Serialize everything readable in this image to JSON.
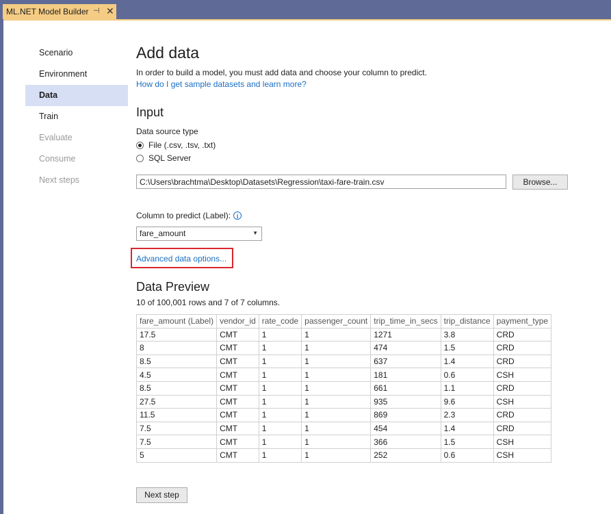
{
  "window": {
    "tab_title": "ML.NET Model Builder",
    "pin_icon": "pin-icon",
    "close_icon": "close-icon"
  },
  "sidebar": {
    "items": [
      {
        "label": "Scenario",
        "state": "normal"
      },
      {
        "label": "Environment",
        "state": "normal"
      },
      {
        "label": "Data",
        "state": "active"
      },
      {
        "label": "Train",
        "state": "normal"
      },
      {
        "label": "Evaluate",
        "state": "disabled"
      },
      {
        "label": "Consume",
        "state": "disabled"
      },
      {
        "label": "Next steps",
        "state": "disabled"
      }
    ]
  },
  "main": {
    "title": "Add data",
    "description": "In order to build a model, you must add data and choose your column to predict.",
    "help_link": "How do I get sample datasets and learn more?",
    "input_heading": "Input",
    "data_source_label": "Data source type",
    "sources": [
      {
        "label": "File (.csv, .tsv, .txt)",
        "checked": true
      },
      {
        "label": "SQL Server",
        "checked": false
      }
    ],
    "file_path": "C:\\Users\\brachtma\\Desktop\\Datasets\\Regression\\taxi-fare-train.csv",
    "browse_label": "Browse...",
    "column_label": "Column to predict (Label):",
    "info_icon": "i",
    "column_value": "fare_amount",
    "advanced_link": "Advanced data options...",
    "preview_heading": "Data Preview",
    "rows_info": "10 of 100,001 rows and 7 of 7 columns.",
    "next_label": "Next step"
  },
  "table": {
    "headers": [
      "fare_amount (Label)",
      "vendor_id",
      "rate_code",
      "passenger_count",
      "trip_time_in_secs",
      "trip_distance",
      "payment_type"
    ],
    "rows": [
      [
        "17.5",
        "CMT",
        "1",
        "1",
        "1271",
        "3.8",
        "CRD"
      ],
      [
        "8",
        "CMT",
        "1",
        "1",
        "474",
        "1.5",
        "CRD"
      ],
      [
        "8.5",
        "CMT",
        "1",
        "1",
        "637",
        "1.4",
        "CRD"
      ],
      [
        "4.5",
        "CMT",
        "1",
        "1",
        "181",
        "0.6",
        "CSH"
      ],
      [
        "8.5",
        "CMT",
        "1",
        "1",
        "661",
        "1.1",
        "CRD"
      ],
      [
        "27.5",
        "CMT",
        "1",
        "1",
        "935",
        "9.6",
        "CSH"
      ],
      [
        "11.5",
        "CMT",
        "1",
        "1",
        "869",
        "2.3",
        "CRD"
      ],
      [
        "7.5",
        "CMT",
        "1",
        "1",
        "454",
        "1.4",
        "CRD"
      ],
      [
        "7.5",
        "CMT",
        "1",
        "1",
        "366",
        "1.5",
        "CSH"
      ],
      [
        "5",
        "CMT",
        "1",
        "1",
        "252",
        "0.6",
        "CSH"
      ]
    ]
  },
  "colors": {
    "titlebar": "#5f6b96",
    "tab_active": "#f5cc84",
    "nav_active": "#d6dff4",
    "link": "#1a6fc4",
    "highlight_box": "#d9262e"
  }
}
